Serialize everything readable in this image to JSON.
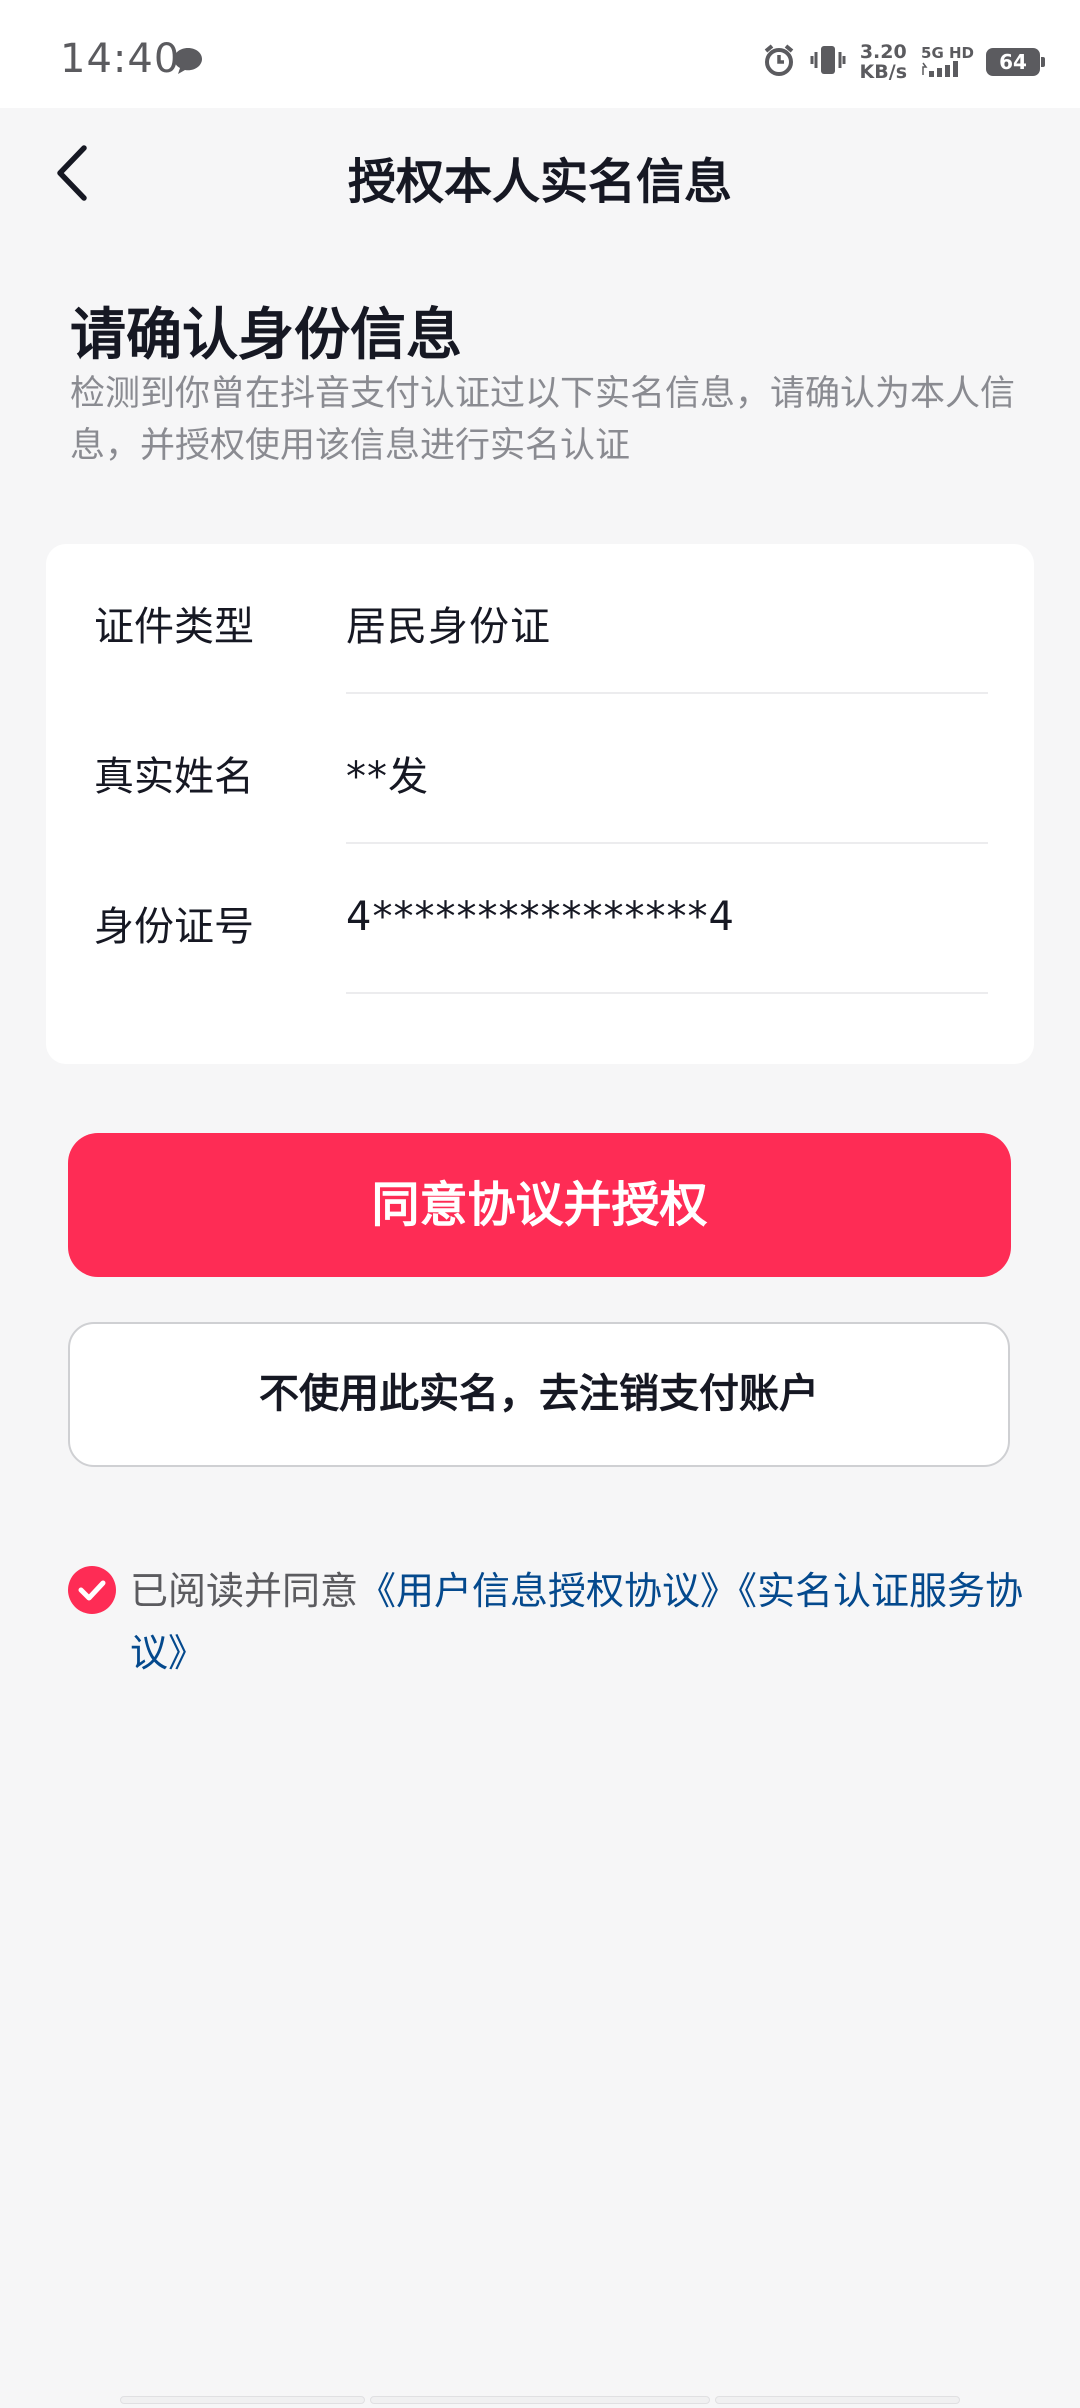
{
  "status_bar": {
    "time": "14:40",
    "net_speed_value": "3.20",
    "net_speed_unit": "KB/s",
    "network_type": "5G HD",
    "battery": "64",
    "icons": [
      "chat-bubble-icon",
      "alarm-icon",
      "vibrate-icon",
      "signal-icon",
      "battery-icon"
    ]
  },
  "nav": {
    "title": "授权本人实名信息"
  },
  "heading": "请确认身份信息",
  "description": "检测到你曾在抖音支付认证过以下实名信息，请确认为本人信息，并授权使用该信息进行实名认证",
  "info": {
    "rows": [
      {
        "label": "证件类型",
        "value": "居民身份证"
      },
      {
        "label": "真实姓名",
        "value": "**发"
      },
      {
        "label": "身份证号",
        "value": "4****************4"
      }
    ]
  },
  "buttons": {
    "primary": "同意协议并授权",
    "secondary": "不使用此实名，去注销支付账户"
  },
  "agreement": {
    "prefix": "已阅读并同意",
    "link_1": "《用户信息授权协议》",
    "link_2": "《实名认证服务协议》",
    "checked": true
  },
  "colors": {
    "accent": "#fe2c55",
    "link": "#04498d",
    "background": "#f6f6f7"
  }
}
